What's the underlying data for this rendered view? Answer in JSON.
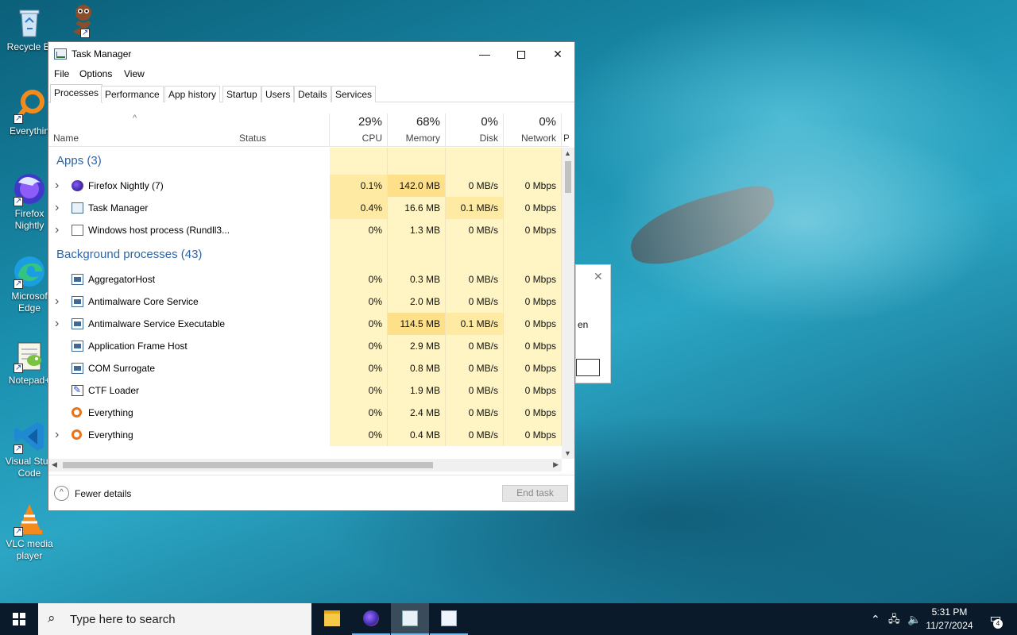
{
  "desktop": {
    "icons": [
      {
        "label": "Recycle Bi",
        "icon": "recycle-bin-icon"
      },
      {
        "label": "",
        "icon": "python-snake-icon"
      },
      {
        "label": "Everythin",
        "icon": "everything-search-icon"
      },
      {
        "label": "Firefox Nightly",
        "icon": "firefox-nightly-icon"
      },
      {
        "label": "Microsof Edge",
        "icon": "edge-icon"
      },
      {
        "label": "Notepad+",
        "icon": "notepad-plus-plus-icon"
      },
      {
        "label": "Visual Stud Code",
        "icon": "vscode-icon"
      },
      {
        "label": "VLC media player",
        "icon": "vlc-icon"
      }
    ]
  },
  "bg_dialog": {
    "text": "en"
  },
  "window": {
    "title": "Task Manager",
    "controls": {
      "minimize": "—",
      "close": "✕"
    }
  },
  "menu": [
    "File",
    "Options",
    "View"
  ],
  "tabs": [
    "Processes",
    "Performance",
    "App history",
    "Startup",
    "Users",
    "Details",
    "Services"
  ],
  "active_tab": "Processes",
  "columns": {
    "name": "Name",
    "status": "Status",
    "cpu": {
      "pct": "29%",
      "label": "CPU"
    },
    "memory": {
      "pct": "68%",
      "label": "Memory"
    },
    "disk": {
      "pct": "0%",
      "label": "Disk"
    },
    "network": {
      "pct": "0%",
      "label": "Network"
    },
    "extra": "P"
  },
  "groups": {
    "apps": "Apps (3)",
    "background": "Background processes (43)"
  },
  "apps": [
    {
      "name": "Firefox Nightly (7)",
      "cpu": "0.1%",
      "mem": "142.0 MB",
      "disk": "0 MB/s",
      "net": "0 Mbps",
      "icon": "firefox-icon"
    },
    {
      "name": "Task Manager",
      "cpu": "0.4%",
      "mem": "16.6 MB",
      "disk": "0.1 MB/s",
      "net": "0 Mbps",
      "icon": "task-manager-icon"
    },
    {
      "name": "Windows host process (Rundll3...",
      "cpu": "0%",
      "mem": "1.3 MB",
      "disk": "0 MB/s",
      "net": "0 Mbps",
      "icon": "document-icon"
    }
  ],
  "background": [
    {
      "name": "AggregatorHost",
      "cpu": "0%",
      "mem": "0.3 MB",
      "disk": "0 MB/s",
      "net": "0 Mbps",
      "icon": "process-icon",
      "expandable": false
    },
    {
      "name": "Antimalware Core Service",
      "cpu": "0%",
      "mem": "2.0 MB",
      "disk": "0 MB/s",
      "net": "0 Mbps",
      "icon": "process-icon",
      "expandable": true
    },
    {
      "name": "Antimalware Service Executable",
      "cpu": "0%",
      "mem": "114.5 MB",
      "disk": "0.1 MB/s",
      "net": "0 Mbps",
      "icon": "process-icon",
      "expandable": true
    },
    {
      "name": "Application Frame Host",
      "cpu": "0%",
      "mem": "2.9 MB",
      "disk": "0 MB/s",
      "net": "0 Mbps",
      "icon": "process-icon",
      "expandable": false
    },
    {
      "name": "COM Surrogate",
      "cpu": "0%",
      "mem": "0.8 MB",
      "disk": "0 MB/s",
      "net": "0 Mbps",
      "icon": "process-icon",
      "expandable": false
    },
    {
      "name": "CTF Loader",
      "cpu": "0%",
      "mem": "1.9 MB",
      "disk": "0 MB/s",
      "net": "0 Mbps",
      "icon": "ctf-loader-icon",
      "expandable": false
    },
    {
      "name": "Everything",
      "cpu": "0%",
      "mem": "2.4 MB",
      "disk": "0 MB/s",
      "net": "0 Mbps",
      "icon": "everything-icon",
      "expandable": false
    },
    {
      "name": "Everything",
      "cpu": "0%",
      "mem": "0.4 MB",
      "disk": "0 MB/s",
      "net": "0 Mbps",
      "icon": "everything-icon",
      "expandable": true
    }
  ],
  "footer": {
    "fewer_details": "Fewer details",
    "end_task": "End task"
  },
  "taskbar": {
    "search_placeholder": "Type here to search",
    "apps": [
      "file-explorer-icon",
      "firefox-icon",
      "task-manager-icon",
      "notepad-icon"
    ],
    "time": "5:31 PM",
    "date": "11/27/2024",
    "notifications": "4"
  },
  "colors": {
    "group_header": "#2e65a6",
    "cell_light": "#fff4c4",
    "cell_medium": "#ffeaa3",
    "cell_mem_high": "#ffe08a"
  }
}
